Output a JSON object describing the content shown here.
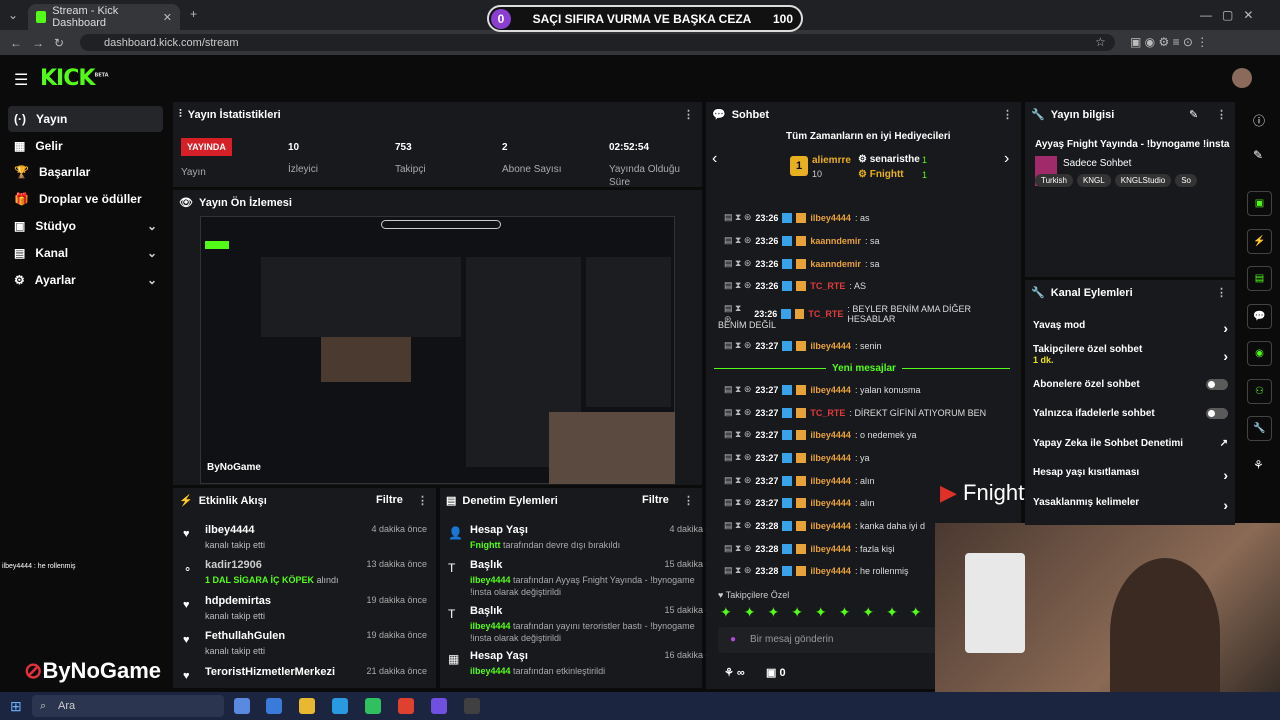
{
  "browser": {
    "tab_title": "Stream - Kick Dashboard",
    "url": "dashboard.kick.com/stream"
  },
  "poll": {
    "left": "0",
    "question": "SAÇI SIFIRA VURMA VE BAŞKA CEZA",
    "right": "100"
  },
  "app": {
    "logo": "KICK",
    "logo_sup": "BETA"
  },
  "sidebar": {
    "items": [
      {
        "label": "Yayın",
        "icon": "(·)"
      },
      {
        "label": "Gelir",
        "icon": "▦"
      },
      {
        "label": "Başarılar",
        "icon": "🏆"
      },
      {
        "label": "Droplar ve ödüller",
        "icon": "🎁"
      },
      {
        "label": "Stüdyo",
        "icon": "▣"
      },
      {
        "label": "Kanal",
        "icon": "▤"
      },
      {
        "label": "Ayarlar",
        "icon": "⚙"
      }
    ]
  },
  "stats": {
    "title": "Yayın İstatistikleri",
    "live": "YAYINDA",
    "live_label": "Yayın",
    "viewers": "10",
    "viewers_label": "İzleyici",
    "followers": "753",
    "followers_label": "Takipçi",
    "subs": "2",
    "subs_label": "Abone Sayısı",
    "duration": "02:52:54",
    "duration_label": "Yayında Olduğu Süre"
  },
  "preview": {
    "title": "Yayın Ön İzlemesi"
  },
  "overlay": {
    "chat_line": "ilbey4444 : he rollenmiş",
    "yt_name": "Fnightt",
    "brand": "ByNoGame"
  },
  "activity": {
    "title": "Etkinlik Akışı",
    "filter": "Filtre",
    "items": [
      {
        "user": "ilbey4444",
        "desc": "kanalı takip etti",
        "time": "4 dakika önce"
      },
      {
        "user": "kadir12906",
        "desc": "1 DAL SİGARA İÇ KÖPEK",
        "desc2": "alındı",
        "time": "13 dakika önce"
      },
      {
        "user": "hdpdemirtas",
        "desc": "kanalı takip etti",
        "time": "19 dakika önce"
      },
      {
        "user": "FethullahGulen",
        "desc": "kanalı takip etti",
        "time": "19 dakika önce"
      },
      {
        "user": "TeroristHizmetlerMerkezi",
        "desc": "",
        "time": "21 dakika önce"
      }
    ]
  },
  "moderation": {
    "title": "Denetim Eylemleri",
    "filter": "Filtre",
    "items": [
      {
        "head": "Hesap Yaşı",
        "who": "Fnightt",
        "rest": "tarafından devre dışı bırakıldı",
        "time": "4 dakika önce"
      },
      {
        "head": "Başlık",
        "who": "ilbey4444",
        "rest": "tarafından Ayyaş Fnight Yayında - !bynogame !insta olarak değiştirildi",
        "time": "15 dakika önce"
      },
      {
        "head": "Başlık",
        "who": "ilbey4444",
        "rest": "tarafından yayını teroristler bastı - !bynogame !insta olarak değiştirildi",
        "time": "15 dakika önce"
      },
      {
        "head": "Hesap Yaşı",
        "who": "ilbey4444",
        "rest": "tarafından etkinleştirildi",
        "time": "16 dakika önce"
      }
    ]
  },
  "chat": {
    "title": "Sohbet",
    "top_title": "Tüm Zamanların en iyi Hediyecileri",
    "top": [
      {
        "rank": "1",
        "name": "aliemrre",
        "count": "10"
      },
      {
        "name": "senaristhe",
        "count": "1"
      },
      {
        "name": "Fnightt",
        "count": "1"
      }
    ],
    "new_messages": "Yeni mesajlar",
    "followers_only": "Takipçilere Özel",
    "placeholder": "Bir mesaj gönderin",
    "count_a": "∞",
    "count_b": "0",
    "messages": [
      {
        "time": "23:26",
        "user": "ilbey4444",
        "text": "as",
        "color": "#e8a23a"
      },
      {
        "time": "23:26",
        "user": "kaanndemir",
        "text": "sa",
        "color": "#e8a23a"
      },
      {
        "time": "23:26",
        "user": "kaanndemir",
        "text": "sa",
        "color": "#e8a23a"
      },
      {
        "time": "23:26",
        "user": "TC_RTE",
        "text": "AS",
        "color": "#e03a3a"
      },
      {
        "time": "23:26",
        "user": "TC_RTE",
        "text": "BEYLER BENİM AMA DİĞER HESABLAR",
        "color": "#e03a3a"
      },
      {
        "time": "23:27",
        "user": "ilbey4444",
        "text": "senin",
        "color": "#e8a23a"
      },
      {
        "time": "23:27",
        "user": "ilbey4444",
        "text": "yalan konusma",
        "color": "#e8a23a"
      },
      {
        "time": "23:27",
        "user": "TC_RTE",
        "text": "DİREKT GİFİNİ ATIYORUM BEN",
        "color": "#e03a3a"
      },
      {
        "time": "23:27",
        "user": "ilbey4444",
        "text": "o nedemek ya",
        "color": "#e8a23a"
      },
      {
        "time": "23:27",
        "user": "ilbey4444",
        "text": "ya",
        "color": "#e8a23a"
      },
      {
        "time": "23:27",
        "user": "ilbey4444",
        "text": "alın",
        "color": "#e8a23a"
      },
      {
        "time": "23:27",
        "user": "ilbey4444",
        "text": "alın",
        "color": "#e8a23a"
      },
      {
        "time": "23:28",
        "user": "ilbey4444",
        "text": "kanka daha iyi d",
        "color": "#e8a23a"
      },
      {
        "time": "23:28",
        "user": "ilbey4444",
        "text": "fazla kişi",
        "color": "#e8a23a"
      },
      {
        "time": "23:28",
        "user": "ilbey4444",
        "text": "he rollenmiş",
        "color": "#e8a23a"
      }
    ],
    "wrap": "BENİM DEĞİL"
  },
  "info": {
    "title": "Yayın bilgisi",
    "stream_title": "Ayyaş Fnight Yayında - !bynogame !insta",
    "category": "Sadece Sohbet",
    "tags": [
      "Turkish",
      "KNGL",
      "KNGLStudio",
      "So"
    ]
  },
  "channel_actions": {
    "title": "Kanal Eylemleri",
    "items": [
      {
        "label": "Yavaş mod",
        "type": "arrow"
      },
      {
        "label": "Takipçilere özel sohbet",
        "sub": "1 dk.",
        "type": "arrow"
      },
      {
        "label": "Abonelere özel sohbet",
        "type": "toggle"
      },
      {
        "label": "Yalnızca ifadelerle sohbet",
        "type": "toggle"
      },
      {
        "label": "Yapay Zeka ile Sohbet Denetimi",
        "type": "ext"
      },
      {
        "label": "Hesap yaşı kısıtlaması",
        "type": "arrow"
      },
      {
        "label": "Yasaklanmış kelimeler",
        "type": "arrow"
      }
    ]
  },
  "taskbar": {
    "search": "Ara"
  }
}
